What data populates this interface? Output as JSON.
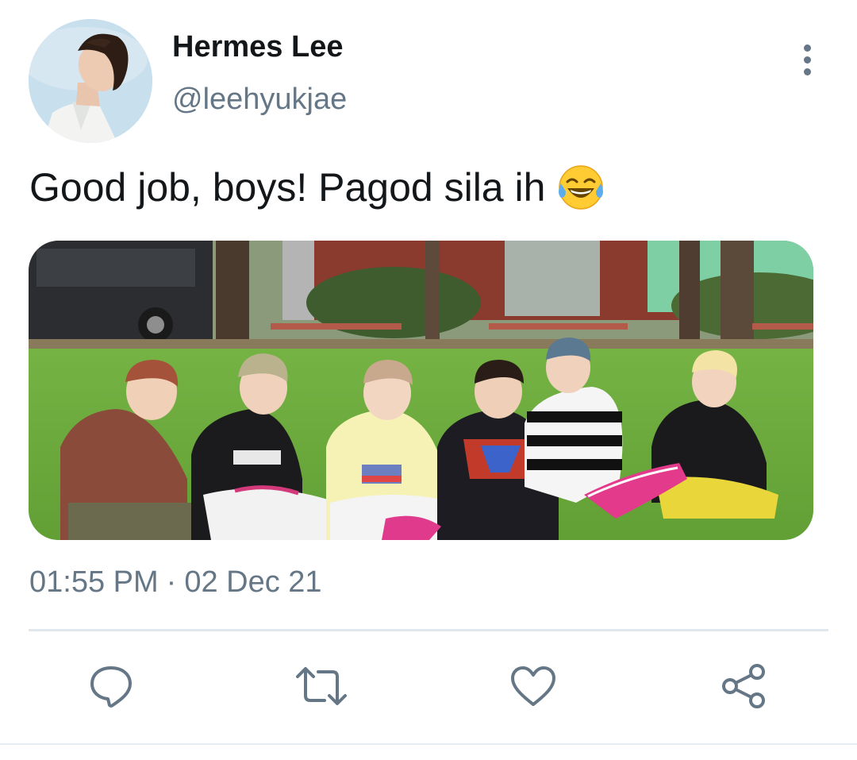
{
  "user": {
    "display_name": "Hermes Lee",
    "handle": "@leehyukjae"
  },
  "tweet": {
    "text": "Good job, boys! Pagod sila ih",
    "emoji": "face-with-tears-of-joy"
  },
  "meta": {
    "time": "01:55 PM",
    "separator": "·",
    "date": "02 Dec 21"
  },
  "actions": {
    "reply": "speech-bubble-icon",
    "retweet": "retweet-icon",
    "like": "heart-icon",
    "share": "share-icon"
  },
  "colors": {
    "primary_text": "#14171a",
    "secondary_text": "#657786",
    "divider": "#e1e8ed"
  }
}
